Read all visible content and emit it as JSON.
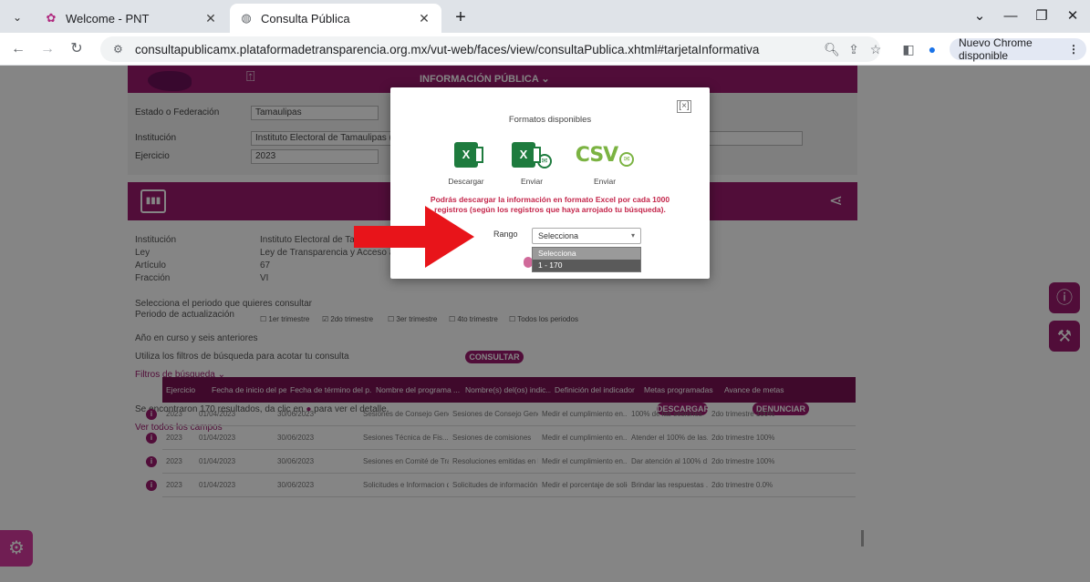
{
  "browser": {
    "tabs": [
      {
        "title": "Welcome - PNT",
        "active": false
      },
      {
        "title": "Consulta Pública",
        "active": true
      }
    ],
    "url": "consultapublicamx.plataformadetransparencia.org.mx/vut-web/faces/view/consultaPublica.xhtml#tarjetaInformativa",
    "update_label": "Nuevo Chrome disponible"
  },
  "header": {
    "menu_label": "INFORMACIÓN PÚBLICA ⌄"
  },
  "filters": {
    "estado_label": "Estado o Federación",
    "estado_value": "Tamaulipas",
    "institucion_label": "Institución",
    "institucion_value": "Instituto Electoral de Tamaulipas (IET",
    "ejercicio_label": "Ejercicio",
    "ejercicio_value": "2023"
  },
  "details": {
    "institucion_label": "Institución",
    "institucion_value": "Instituto Electoral de Tamau",
    "ley_label": "Ley",
    "ley_value": "Ley de Transparencia y Acceso a la In",
    "articulo_label": "Artículo",
    "articulo_value": "67",
    "fraccion_label": "Fracción",
    "fraccion_value": "VI",
    "periodo_prompt": "Selecciona el periodo que quieres consultar",
    "periodo_label": "Periodo de actualización",
    "periodos": [
      "1er trimestre",
      "2do trimestre",
      "3er trimestre",
      "4to trimestre",
      "Todos los periodos"
    ],
    "anio_text": "Año en curso y seis anteriores",
    "filtros_hint": "Utiliza los filtros de búsqueda para acotar tu consulta",
    "consultar_label": "CONSULTAR",
    "filtros_link": "Filtros de búsqueda ⌄",
    "resultados_text": "Se encontraron 170 resultados, da clic en",
    "resultados_tail": "para ver el detalle.",
    "descargar_label": "DESCARGAR",
    "denunciar_label": "DENUNCIAR",
    "ver_campos": "Ver todos los campos"
  },
  "table": {
    "headers": [
      "Ejercicio",
      "Fecha de inicio del peri...",
      "Fecha de término del p...",
      "Nombre del programa ...",
      "Nombre(s) del(os) indic...",
      "Definición del indicador",
      "Metas programadas",
      "Avance de metas"
    ],
    "rows": [
      [
        "2023",
        "01/04/2023",
        "30/06/2023",
        "Sesiones de Consejo General",
        "Sesiones de Consejo General",
        "Medir el cumplimiento en...",
        "100% de las sesiones",
        "2do trimestre 100%"
      ],
      [
        "2023",
        "01/04/2023",
        "30/06/2023",
        "Sesiones Técnica de Fis...",
        "Sesiones de comisiones",
        "Medir el cumplimiento en...",
        "Atender el 100% de las...",
        "2do trimestre 100%"
      ],
      [
        "2023",
        "01/04/2023",
        "30/06/2023",
        "Sesiones en Comité de Tran...",
        "Resoluciones emitidas en l...",
        "Medir el cumplimiento en...",
        "Dar atención al 100% d...",
        "2do trimestre 100%"
      ],
      [
        "2023",
        "01/04/2023",
        "30/06/2023",
        "Solicitudes e Informacion de ...",
        "Solicitudes de información ...",
        "Medir el porcentaje de solic...",
        "Brindar las respuestas ...",
        "2do trimestre 0.0%"
      ]
    ]
  },
  "modal": {
    "close_label": "[×]",
    "title": "Formatos disponibles",
    "formats": [
      {
        "label": "Descargar",
        "icon": "excel-icon"
      },
      {
        "label": "Enviar",
        "icon": "excel-send-icon"
      },
      {
        "label": "Enviar",
        "icon": "csv-send-icon"
      }
    ],
    "message": "Podrás descargar la información en formato Excel por cada 1000 registros (según los registros que haya arrojado tu búsqueda).",
    "rango_label": "Rango",
    "rango_value": "Selecciona",
    "options": [
      "Selecciona",
      "1 - 170"
    ],
    "csv_text": "CSV"
  },
  "colors": {
    "brand": "#9c1a6d",
    "message": "#c4264b",
    "excel": "#1e7b3e",
    "csv": "#7bb342",
    "arrow": "#e8141a"
  }
}
